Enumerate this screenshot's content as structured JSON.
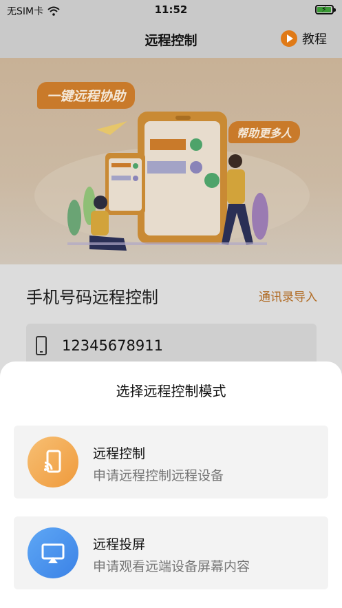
{
  "status_bar": {
    "carrier": "无SIM卡",
    "time": "11:52"
  },
  "nav": {
    "title": "远程控制",
    "tutorial_label": "教程"
  },
  "banner": {
    "badge_left": "一键远程协助",
    "badge_right": "帮助更多人"
  },
  "phone_section": {
    "title": "手机号码远程控制",
    "import_label": "通讯录导入",
    "phone_value": "12345678911"
  },
  "sheet": {
    "title": "选择远程控制模式",
    "options": [
      {
        "title": "远程控制",
        "desc": "申请远程控制远程设备",
        "icon": "remote-control-icon",
        "color": "#f2a64e"
      },
      {
        "title": "远程投屏",
        "desc": "申请观看远端设备屏幕内容",
        "icon": "screen-cast-icon",
        "color": "#4a91ee"
      }
    ]
  },
  "colors": {
    "accent": "#e07a17",
    "link": "#b06a22",
    "sheet_bg": "#ffffff"
  }
}
